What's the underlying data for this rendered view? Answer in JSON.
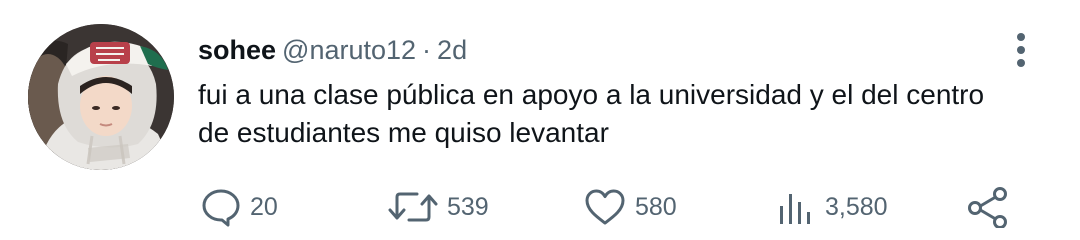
{
  "tweet": {
    "author_name": "sohee",
    "author_handle": "@naruto12",
    "separator": "·",
    "timestamp": "2d",
    "text": "fui a una clase pública en apoyo a la universidad y el del centro de estudiantes me quiso levantar"
  },
  "actions": {
    "replies": "20",
    "retweets": "539",
    "likes": "580",
    "views": "3,580"
  },
  "icons": {
    "avatar": "profile-photo",
    "more": "more-vertical-icon",
    "reply": "reply-icon",
    "retweet": "retweet-icon",
    "like": "heart-icon",
    "views": "views-icon",
    "share": "share-icon"
  },
  "colors": {
    "text": "#0f1419",
    "secondary": "#536471",
    "background": "#ffffff"
  }
}
